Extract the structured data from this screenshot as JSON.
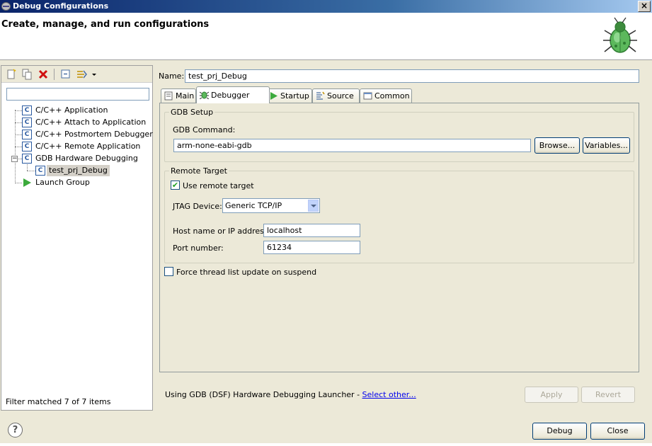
{
  "window": {
    "title": "Debug Configurations",
    "close_label": "×",
    "header_title": "Create, manage, and run configurations"
  },
  "left": {
    "filter_value": "",
    "tree": [
      {
        "label": "C/C++ Application",
        "icon": "c-config-icon"
      },
      {
        "label": "C/C++ Attach to Application",
        "icon": "c-config-icon"
      },
      {
        "label": "C/C++ Postmortem Debugger",
        "icon": "c-config-icon"
      },
      {
        "label": "C/C++ Remote Application",
        "icon": "c-config-icon"
      },
      {
        "label": "GDB Hardware Debugging",
        "icon": "c-config-icon",
        "expanded": true
      },
      {
        "label": "test_prj_Debug",
        "icon": "c-config-icon",
        "selected": true
      },
      {
        "label": "Launch Group",
        "icon": "launch-group-icon"
      }
    ],
    "filter_status": "Filter matched 7 of 7 items"
  },
  "config": {
    "name_label": "Name:",
    "name_value": "test_prj_Debug",
    "tabs": [
      {
        "label": "Main",
        "icon": "main-tab-icon"
      },
      {
        "label": "Debugger",
        "icon": "debugger-tab-icon",
        "active": true
      },
      {
        "label": "Startup",
        "icon": "startup-tab-icon"
      },
      {
        "label": "Source",
        "icon": "source-tab-icon"
      },
      {
        "label": "Common",
        "icon": "common-tab-icon"
      }
    ],
    "gdb_setup": {
      "title": "GDB Setup",
      "command_label": "GDB Command:",
      "command_value": "arm-none-eabi-gdb",
      "browse_label": "Browse...",
      "variables_label": "Variables..."
    },
    "remote_target": {
      "title": "Remote Target",
      "use_remote_label": "Use remote target",
      "use_remote_checked": true,
      "jtag_label": "JTAG Device:",
      "jtag_value": "Generic TCP/IP",
      "host_label": "Host name or IP address:",
      "host_value": "localhost",
      "port_label": "Port number:",
      "port_value": "61234"
    },
    "force_thread_label": "Force thread list update on suspend",
    "force_thread_checked": false,
    "launcher_text": "Using GDB (DSF) Hardware Debugging Launcher - ",
    "select_other_label": "Select other...",
    "apply_label": "Apply",
    "revert_label": "Revert"
  },
  "footer": {
    "debug_label": "Debug",
    "close_label": "Close",
    "help_label": "?"
  }
}
